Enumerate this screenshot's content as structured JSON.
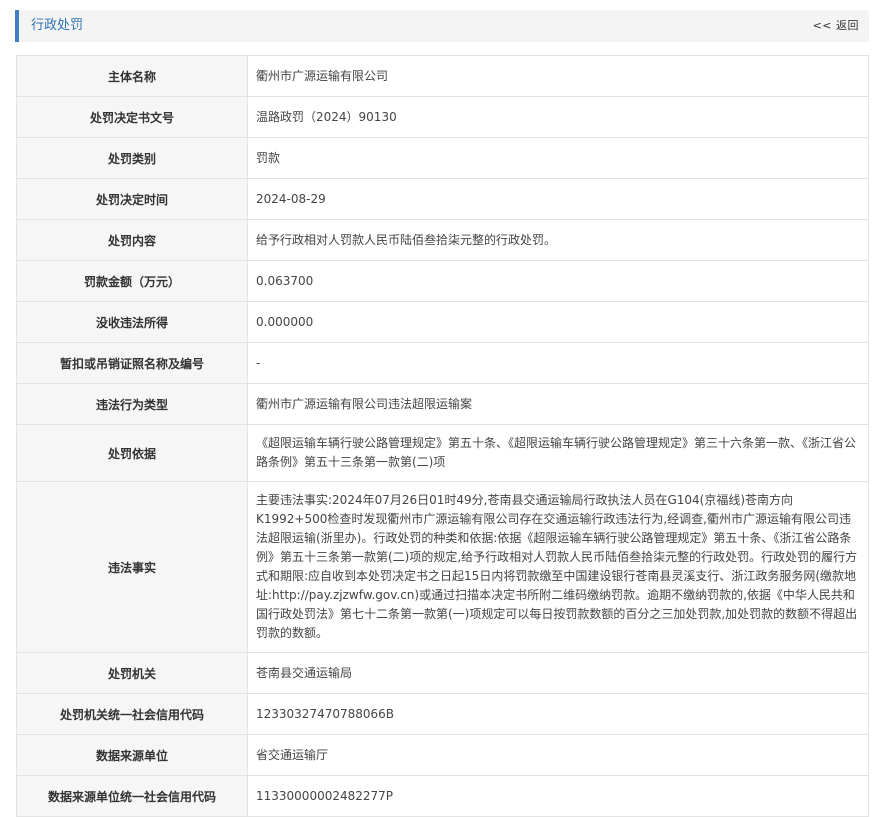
{
  "header": {
    "title": "行政处罚",
    "back_label": "<< 返回"
  },
  "rows": [
    {
      "label": "主体名称",
      "value": "衢州市广源运输有限公司"
    },
    {
      "label": "处罚决定书文号",
      "value": "温路政罚（2024）90130"
    },
    {
      "label": "处罚类别",
      "value": "罚款"
    },
    {
      "label": "处罚决定时间",
      "value": "2024-08-29"
    },
    {
      "label": "处罚内容",
      "value": "给予行政相对人罚款人民币陆佰叁拾柒元整的行政处罚。"
    },
    {
      "label": "罚款金额（万元）",
      "value": "0.063700"
    },
    {
      "label": "没收违法所得",
      "value": "0.000000"
    },
    {
      "label": "暂扣或吊销证照名称及编号",
      "value": "-"
    },
    {
      "label": "违法行为类型",
      "value": "衢州市广源运输有限公司违法超限运输案"
    },
    {
      "label": "处罚依据",
      "value": "《超限运输车辆行驶公路管理规定》第五十条、《超限运输车辆行驶公路管理规定》第三十六条第一款、《浙江省公路条例》第五十三条第一款第(二)项"
    },
    {
      "label": "违法事实",
      "value": "主要违法事实:2024年07月26日01时49分,苍南县交通运输局行政执法人员在G104(京福线)苍南方向K1992+500检查时发现衢州市广源运输有限公司存在交通运输行政违法行为,经调查,衢州市广源运输有限公司违法超限运输(浙里办)。行政处罚的种类和依据:依据《超限运输车辆行驶公路管理规定》第五十条、《浙江省公路条例》第五十三条第一款第(二)项的规定,给予行政相对人罚款人民币陆佰叁拾柒元整的行政处罚。行政处罚的履行方式和期限:应自收到本处罚决定书之日起15日内将罚款缴至中国建设银行苍南县灵溪支行、浙江政务服务网(缴款地址:http://pay.zjzwfw.gov.cn)或通过扫描本决定书所附二维码缴纳罚款。逾期不缴纳罚款的,依据《中华人民共和国行政处罚法》第七十二条第一款第(一)项规定可以每日按罚款数额的百分之三加处罚款,加处罚款的数额不得超出罚款的数额。"
    },
    {
      "label": "处罚机关",
      "value": "苍南县交通运输局"
    },
    {
      "label": "处罚机关统一社会信用代码",
      "value": "12330327470788066B"
    },
    {
      "label": "数据来源单位",
      "value": "省交通运输厅"
    },
    {
      "label": "数据来源单位统一社会信用代码",
      "value": "11330000002482277P"
    }
  ]
}
